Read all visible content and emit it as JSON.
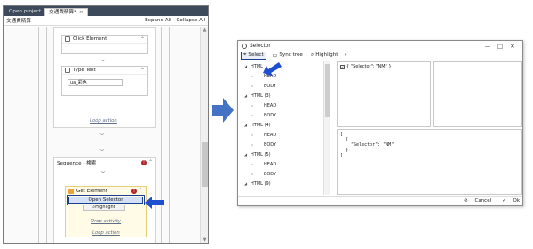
{
  "left": {
    "tabs": [
      {
        "label": "Open project"
      },
      {
        "label": "交通費精算*",
        "close": "×"
      }
    ],
    "breadcrumb": "交通費精算",
    "expand_all": "Expand All",
    "collapse_all": "Collapse All",
    "click_element": {
      "title": "Click Element"
    },
    "type_text": {
      "title": "Type Text",
      "value": "ua_彩色"
    },
    "loop_action_1": "Loop action",
    "sequence": {
      "title": "Sequence - 検索",
      "error_badge": "!"
    },
    "get_element": {
      "title": "Get Element",
      "error_badge": "!",
      "open_selector": "Open Selector",
      "highlight": "Highlight"
    },
    "drop_activity": "Drop activity",
    "loop_action_2": "Loop action"
  },
  "dialog": {
    "title": "Selector",
    "window_controls": {
      "minimize": "—",
      "maximize": "□",
      "close": "✕"
    },
    "toolbar": {
      "select": "Select",
      "sync_tree": "Sync tree",
      "highlight": "Highlight",
      "more": "»"
    },
    "tree": [
      {
        "label": "HTML",
        "expander": "◢"
      },
      {
        "label": "HEAD",
        "expander": "▷"
      },
      {
        "label": "BODY",
        "expander": "▷"
      },
      {
        "label": "HTML (3)",
        "expander": "◢"
      },
      {
        "label": "HEAD",
        "expander": "▷"
      },
      {
        "label": "BODY",
        "expander": "▷"
      },
      {
        "label": "HTML (4)",
        "expander": "◢"
      },
      {
        "label": "HEAD",
        "expander": "▷"
      },
      {
        "label": "BODY",
        "expander": "▷"
      },
      {
        "label": "HTML (5)",
        "expander": "◢"
      },
      {
        "label": "HEAD",
        "expander": "▷"
      },
      {
        "label": "BODY",
        "expander": "▷"
      },
      {
        "label": "HTML (9)",
        "expander": "◢"
      }
    ],
    "attribute": {
      "checked": "✓",
      "text": "{ \"Selector\": \"NM\" }"
    },
    "editor_lines": [
      "[",
      "  {",
      "    \"Selector\": \"NM\"",
      "  }",
      "]"
    ],
    "footer": {
      "cancel": "Cancel",
      "ok": "Ok"
    }
  },
  "colors": {
    "arrow_blue": "#4472c4",
    "selection_blue": "#1c3f94"
  },
  "icons": [
    "chevron-down-icon",
    "collapse-icon",
    "error-icon",
    "highlight-icon",
    "select-icon",
    "sync-icon",
    "cancel-icon",
    "ok-icon"
  ]
}
